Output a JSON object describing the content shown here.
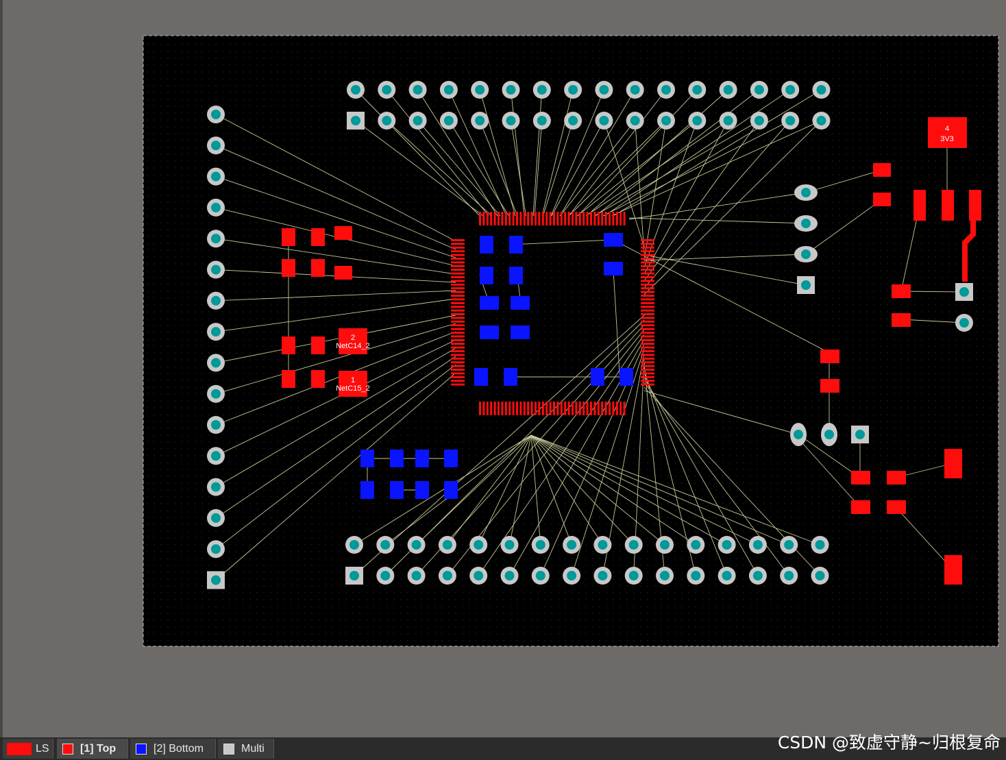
{
  "colors": {
    "top": "#ff0d0d",
    "bottom": "#0a14ff",
    "multi": "#c8c8c8",
    "ratsnest": "#c9c99a",
    "board": "#000000",
    "workspace": "#6e6a68",
    "pad_hole": "#009999"
  },
  "pads": [
    {
      "label": "4",
      "net": "3V3"
    },
    {
      "label": "2",
      "net": "NetC14_2"
    },
    {
      "label": "1",
      "net": "NetC15_2"
    }
  ],
  "layer_tabs": [
    {
      "label": "LS",
      "color": "#ff0d0d"
    },
    {
      "label": "[1] Top",
      "color": "#ff0d0d"
    },
    {
      "label": "[2] Bottom",
      "color": "#0a14ff"
    },
    {
      "label": "Multi",
      "color": "#c8c8c8"
    }
  ],
  "active_layer": "[1] Top",
  "watermark": "CSDN @致虚守静~归根复命"
}
